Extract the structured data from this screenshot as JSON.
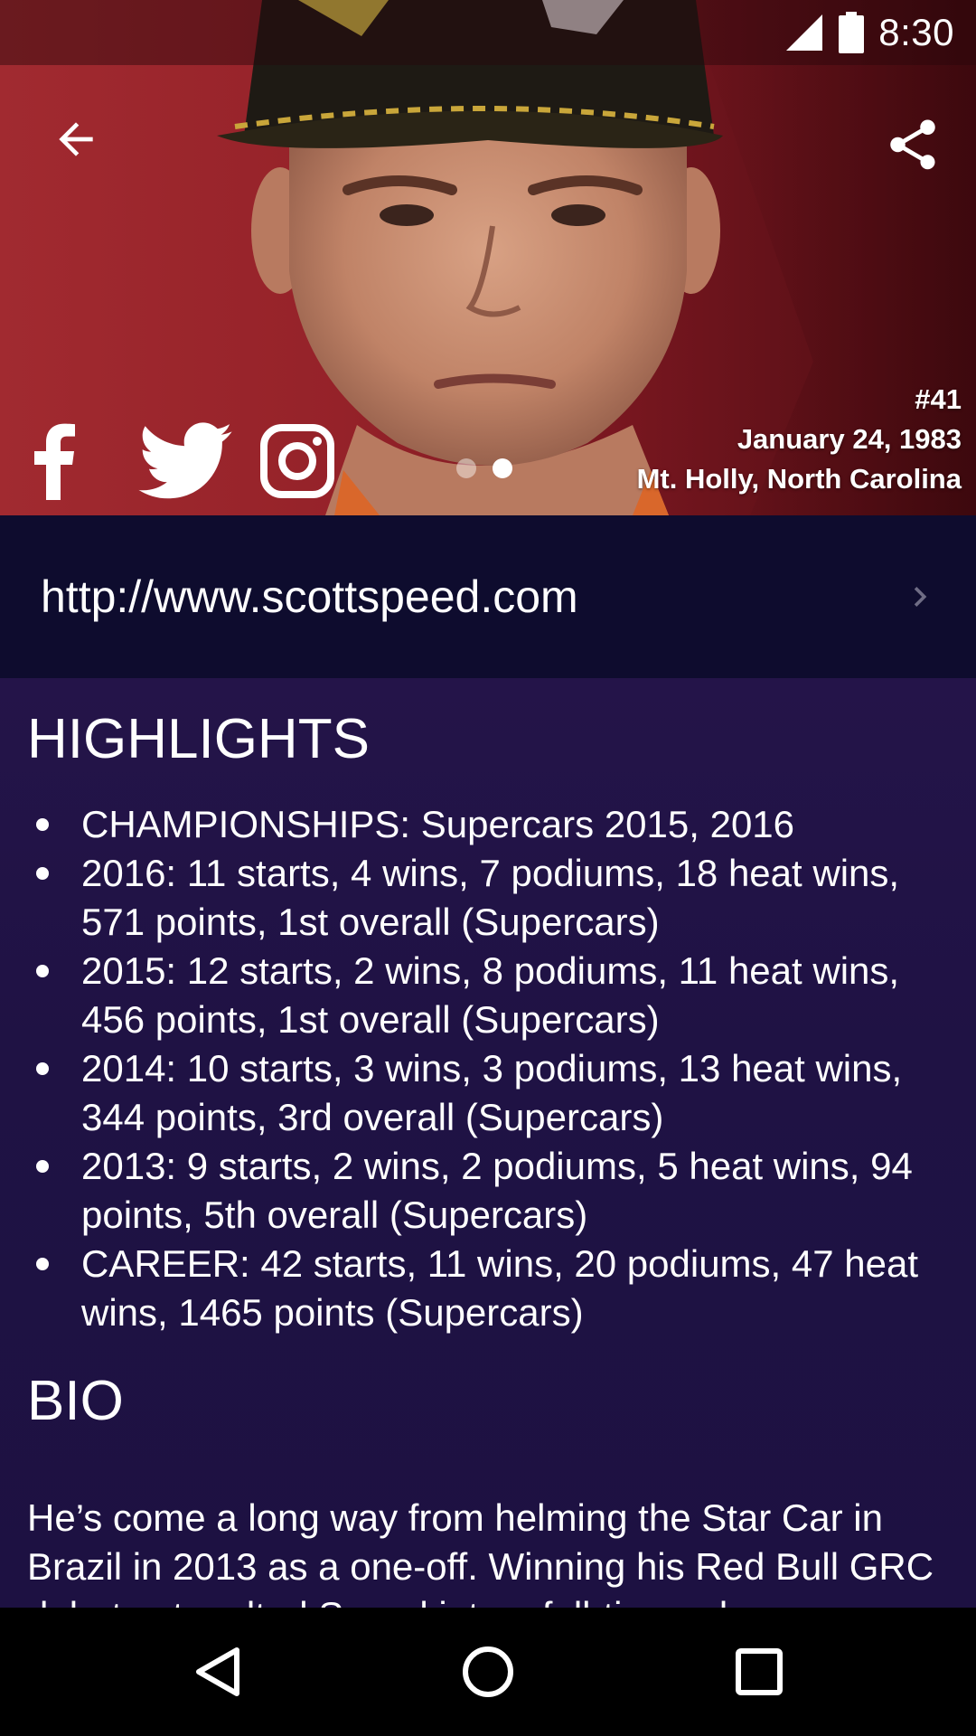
{
  "status_bar": {
    "time": "8:30"
  },
  "hero": {
    "back_icon": "arrow-left-icon",
    "share_icon": "share-icon",
    "social": [
      {
        "icon": "facebook-icon"
      },
      {
        "icon": "twitter-icon"
      },
      {
        "icon": "instagram-icon"
      }
    ],
    "pager": {
      "count": 2,
      "active_index": 1
    },
    "driver": {
      "number": "#41",
      "birthdate": "January 24, 1983",
      "hometown": "Mt. Holly, North Carolina"
    }
  },
  "website": {
    "url": "http://www.scottspeed.com",
    "chevron_icon": "chevron-right-icon"
  },
  "highlights": {
    "title": "HIGHLIGHTS",
    "items": [
      "CHAMPIONSHIPS: Supercars 2015, 2016",
      "2016: 11 starts, 4 wins, 7 podiums, 18 heat wins, 571 points, 1st overall (Supercars)",
      "2015: 12 starts, 2 wins, 8 podiums, 11 heat wins, 456 points, 1st overall (Supercars)",
      "2014: 10 starts, 3 wins, 3 podiums, 13 heat wins, 344 points, 3rd overall (Supercars)",
      "2013: 9 starts, 2 wins, 2 podiums, 5 heat wins, 94 points, 5th overall (Supercars)",
      "CAREER: 42 starts, 11 wins, 20 podiums, 47 heat wins, 1465 points (Supercars)"
    ]
  },
  "bio": {
    "title": "BIO",
    "text": "He’s come a long way from helming the Star Car in Brazil in 2013 as a one-off. Winning his Red Bull GRC debut catapulted Speed into a full-time role, a"
  },
  "nav_bar": {
    "back_icon": "nav-back-icon",
    "home_icon": "nav-home-icon",
    "recents_icon": "nav-recents-icon"
  },
  "colors": {
    "hero_red": "#a12a30",
    "website_bg": "#0e0c2e",
    "content_bg": "#1f1244",
    "nav_bg": "#000000"
  }
}
